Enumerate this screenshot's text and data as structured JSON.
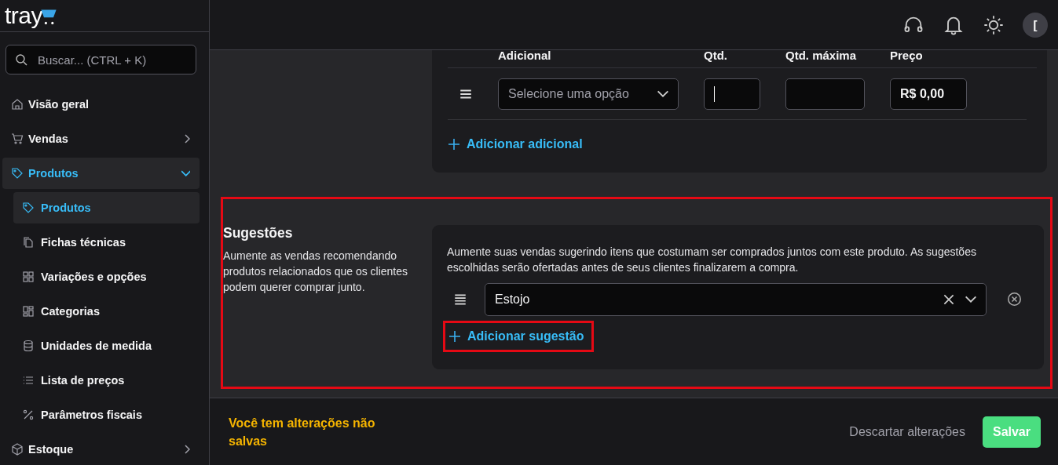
{
  "logo": {
    "text": "tray"
  },
  "search": {
    "placeholder": "Buscar... (CTRL + K)"
  },
  "sidebar": {
    "items": [
      {
        "label": "Visão geral",
        "selected": false
      },
      {
        "label": "Vendas",
        "selected": false,
        "expanded": false
      },
      {
        "label": "Produtos",
        "selected": true,
        "expanded": true,
        "children": [
          {
            "label": "Produtos",
            "selected": true
          },
          {
            "label": "Fichas técnicas",
            "selected": false
          },
          {
            "label": "Variações e opções",
            "selected": false
          },
          {
            "label": "Categorias",
            "selected": false
          },
          {
            "label": "Unidades de medida",
            "selected": false
          },
          {
            "label": "Lista de preços",
            "selected": false
          },
          {
            "label": "Parâmetros fiscais",
            "selected": false
          }
        ]
      },
      {
        "label": "Estoque",
        "selected": false,
        "expanded": false
      }
    ]
  },
  "header": {
    "avatar": "["
  },
  "additionals": {
    "columns": [
      "Adicional",
      "Qtd.",
      "Qtd. máxima",
      "Preço"
    ],
    "row": {
      "select_placeholder": "Selecione uma opção",
      "price": "R$ 0,00"
    },
    "add_button": "Adicionar adicional"
  },
  "suggestions": {
    "title": "Sugestões",
    "description": "Aumente as vendas recomendando produtos relacionados que os clientes podem querer comprar junto.",
    "highlighted": true,
    "intro": "Aumente suas vendas sugerindo itens que costumam ser comprados juntos com este produto. As sugestões escolhidas serão ofertadas antes de seus clientes finalizarem a compra.",
    "items": [
      {
        "value": "Estojo"
      }
    ],
    "add_button": {
      "label": "Adicionar sugestão",
      "highlighted": true
    }
  },
  "footer": {
    "message": "Você tem alterações não salvas",
    "discard": "Descartar alterações",
    "save": "Salvar"
  }
}
